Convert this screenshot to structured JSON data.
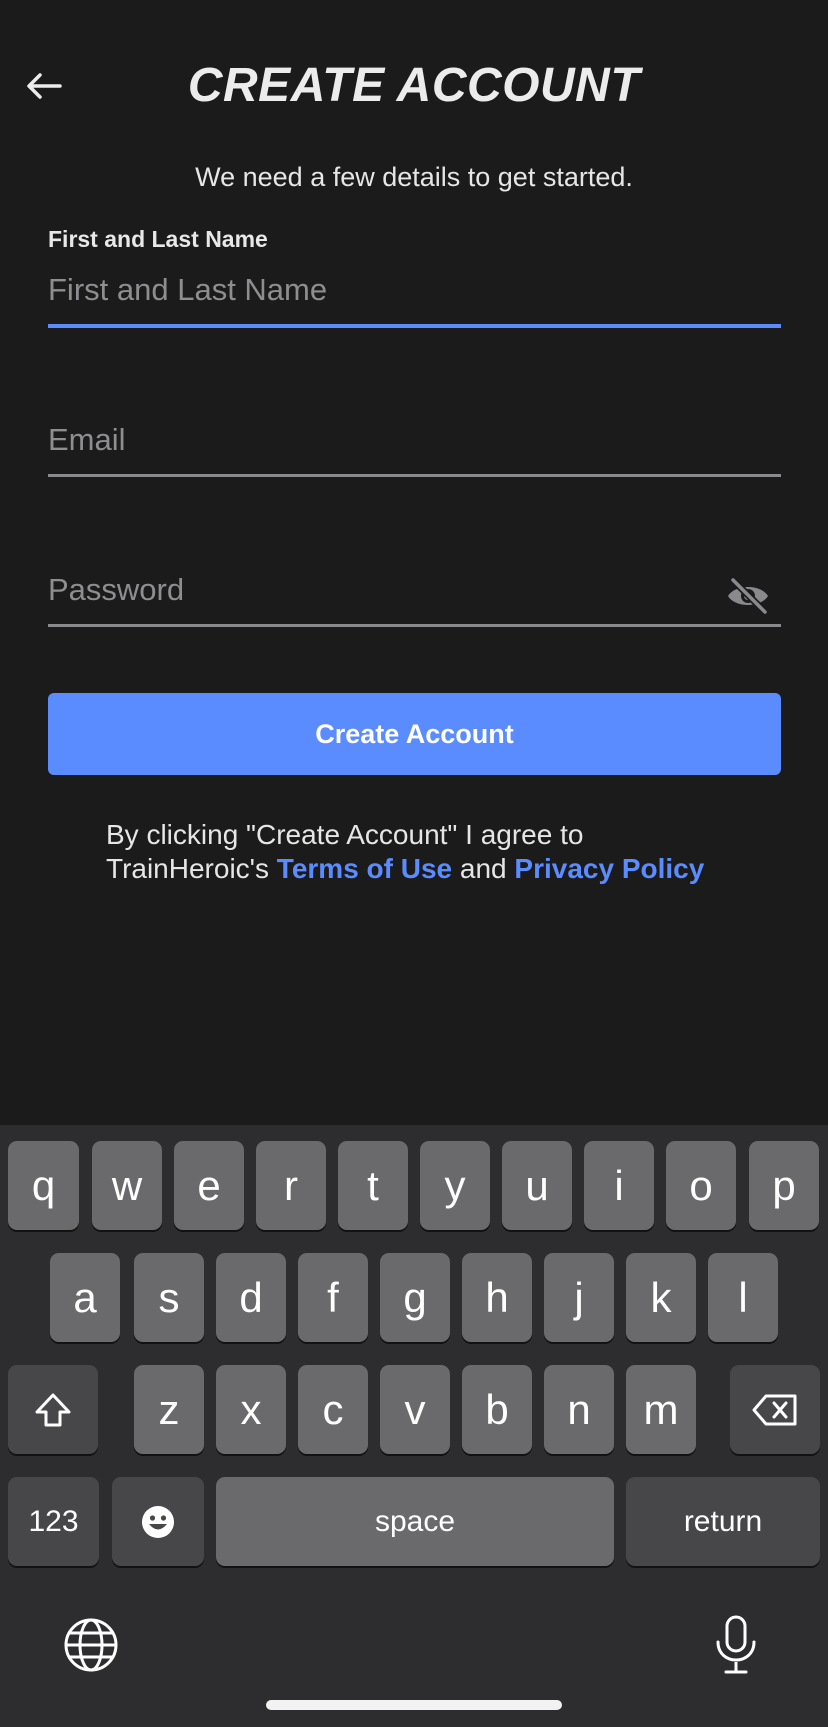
{
  "header": {
    "title": "CREATE ACCOUNT",
    "subtitle": "We need a few details to get started."
  },
  "form": {
    "name": {
      "label": "First and Last Name",
      "placeholder": "First and Last Name",
      "value": ""
    },
    "email": {
      "placeholder": "Email",
      "value": ""
    },
    "password": {
      "placeholder": "Password",
      "value": ""
    },
    "submit_label": "Create Account"
  },
  "legal": {
    "prefix": "By clicking \"Create Account\" I agree to TrainHeroic's ",
    "terms_link": "Terms of Use",
    "middle": " and ",
    "privacy_link": "Privacy Policy"
  },
  "keyboard": {
    "row1": [
      "q",
      "w",
      "e",
      "r",
      "t",
      "y",
      "u",
      "i",
      "o",
      "p"
    ],
    "row2": [
      "a",
      "s",
      "d",
      "f",
      "g",
      "h",
      "j",
      "k",
      "l"
    ],
    "row3": [
      "z",
      "x",
      "c",
      "v",
      "b",
      "n",
      "m"
    ],
    "numbers_label": "123",
    "space_label": "space",
    "return_label": "return"
  },
  "colors": {
    "accent": "#5b8cff",
    "background": "#1b1b1c",
    "keyboard_bg": "#2d2d2f"
  }
}
